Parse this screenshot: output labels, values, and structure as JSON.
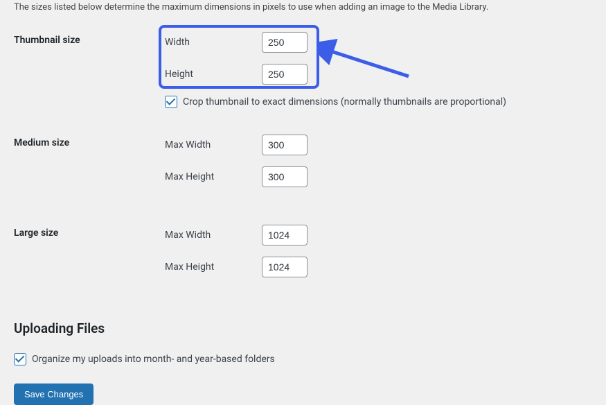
{
  "intro": "The sizes listed below determine the maximum dimensions in pixels to use when adding an image to the Media Library.",
  "thumbnail": {
    "label": "Thumbnail size",
    "width_label": "Width",
    "width_value": "250",
    "height_label": "Height",
    "height_value": "250",
    "crop_label": "Crop thumbnail to exact dimensions (normally thumbnails are proportional)"
  },
  "medium": {
    "label": "Medium size",
    "width_label": "Max Width",
    "width_value": "300",
    "height_label": "Max Height",
    "height_value": "300"
  },
  "large": {
    "label": "Large size",
    "width_label": "Max Width",
    "width_value": "1024",
    "height_label": "Max Height",
    "height_value": "1024"
  },
  "uploading": {
    "heading": "Uploading Files",
    "organize_label": "Organize my uploads into month- and year-based folders"
  },
  "save_label": "Save Changes"
}
